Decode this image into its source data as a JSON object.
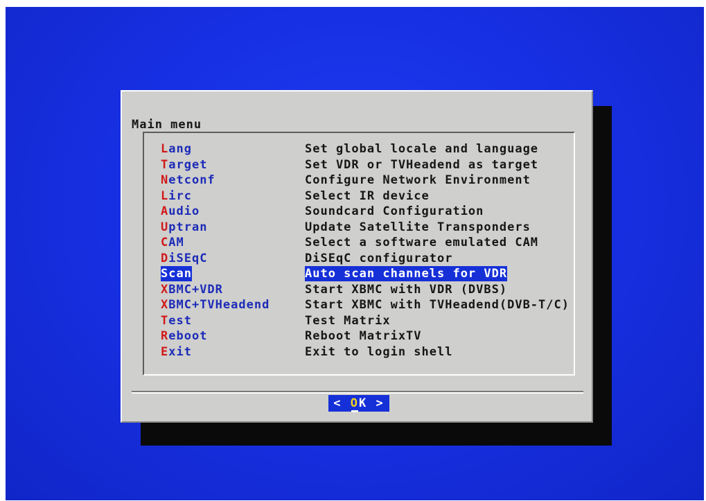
{
  "dialog": {
    "title": "Main menu",
    "items": [
      {
        "hotkey": "L",
        "rest": "ang",
        "desc": "Set global locale and language"
      },
      {
        "hotkey": "T",
        "rest": "arget",
        "desc": "Set VDR or TVHeadend as target"
      },
      {
        "hotkey": "N",
        "rest": "etconf",
        "desc": "Configure Network Environment"
      },
      {
        "hotkey": "L",
        "rest": "irc",
        "desc": "Select IR device"
      },
      {
        "hotkey": "A",
        "rest": "udio",
        "desc": "Soundcard Configuration"
      },
      {
        "hotkey": "U",
        "rest": "ptran",
        "desc": "Update Satellite Transponders"
      },
      {
        "hotkey": "C",
        "rest": "AM",
        "desc": "Select a software emulated CAM"
      },
      {
        "hotkey": "D",
        "rest": "iSEqC",
        "desc": "DiSEqC configurator"
      },
      {
        "hotkey": "S",
        "rest": "can",
        "desc": "Auto scan channels for VDR"
      },
      {
        "hotkey": "X",
        "rest": "BMC+VDR",
        "desc": "Start XBMC with VDR (DVBS)"
      },
      {
        "hotkey": "X",
        "rest": "BMC+TVHeadend",
        "desc": "Start XBMC with TVHeadend(DVB-T/C)"
      },
      {
        "hotkey": "T",
        "rest": "est",
        "desc": "Test Matrix"
      },
      {
        "hotkey": "R",
        "rest": "eboot",
        "desc": "Reboot MatrixTV"
      },
      {
        "hotkey": "E",
        "rest": "xit",
        "desc": "Exit to login shell"
      }
    ],
    "selected_index": 8,
    "ok": {
      "left": "<",
      "hotkey": "O",
      "rest": "K",
      "right": ">"
    }
  },
  "colors": {
    "background": "#1730e4",
    "dialog": "#cfcfcd",
    "tag": "#1c2bb8",
    "hotkey": "#d01818",
    "highlight": "#1630d8"
  }
}
